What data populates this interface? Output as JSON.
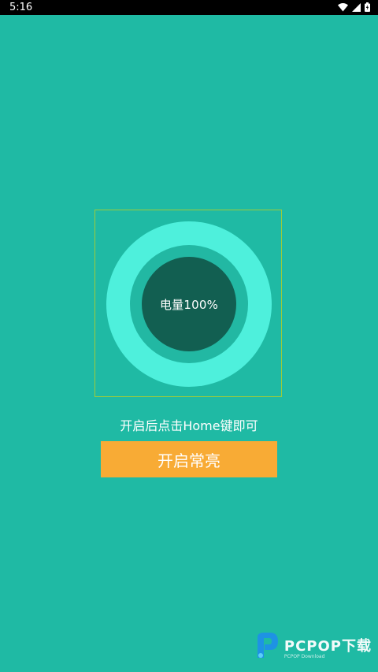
{
  "status_bar": {
    "time": "5:16",
    "icons": [
      "wifi-icon",
      "signal-icon",
      "battery-icon"
    ]
  },
  "battery_ring": {
    "label": "电量100%",
    "level_percent": 100,
    "colors": {
      "outer": "#4ef0dc",
      "middle": "#22b8a3",
      "inner": "#125f51",
      "frame": "#9dcc3a"
    }
  },
  "hint": "开启后点击Home键即可",
  "start_button": {
    "label": "开启常亮",
    "color": "#f8ab35"
  },
  "watermark": {
    "brand": "PCPOP下载",
    "sub": "PCPOP Download"
  },
  "colors": {
    "background": "#1fbaa4",
    "status_bar": "#000000"
  }
}
